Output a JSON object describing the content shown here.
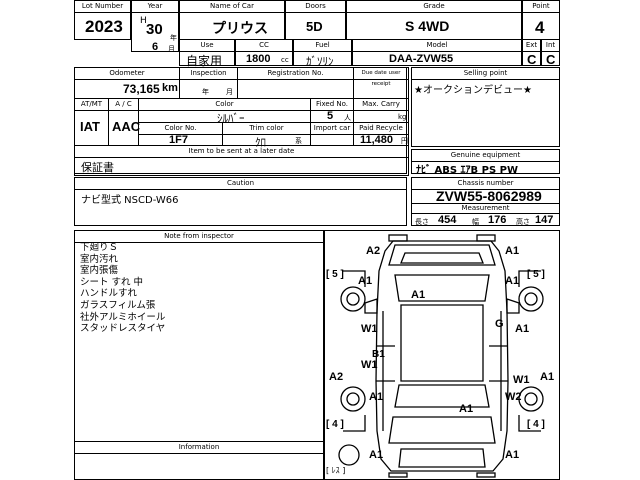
{
  "header": {
    "lot_no_label": "Lot Number",
    "lot_no": "2023",
    "year_label": "Year",
    "era": "H",
    "year": "30",
    "year_unit": "年",
    "month": "6",
    "month_unit": "月",
    "name_label": "Name of Car",
    "name": "プリウス",
    "doors_label": "Doors",
    "doors": "5D",
    "grade_label": "Grade",
    "grade": "S 4WD",
    "point_label": "Point",
    "point": "4",
    "use_label": "Use",
    "use": "自家用",
    "cc_label": "CC",
    "cc": "1800",
    "cc_unit": "cc",
    "fuel_label": "Fuel",
    "fuel": "ｶﾞｿﾘﾝ",
    "model_label": "Model",
    "model": "DAA-ZVW55",
    "ext_label": "Ext",
    "ext": "C",
    "int_label": "Int",
    "int": "C"
  },
  "specs": {
    "odometer_label": "Odometer",
    "odometer": "73,165",
    "odometer_unit": "km",
    "inspection_label": "Inspection",
    "insp_year_unit": "年",
    "insp_month_unit": "月",
    "registration_label": "Registration No.",
    "due_date_label": "Due date user receipt",
    "at_mt_label": "AT/MT",
    "at_mt": "IAT",
    "ac_label": "A / C",
    "ac": "AAC",
    "color_label": "Color",
    "color": "ｼﾙﾊﾞｰ",
    "fixed_no_label": "Fixed No.",
    "fixed_no": "5",
    "fixed_no_unit": "人",
    "max_carry_label": "Max. Carry",
    "max_carry_unit": "kg",
    "color_no_label": "Color No.",
    "color_no": "1F7",
    "trim_color_label": "Trim color",
    "trim_color": "ｸﾛ",
    "trim_unit": "系",
    "import_label": "Import car",
    "recycle_label": "Paid Recycle",
    "recycle": "11,480",
    "recycle_unit": "円",
    "items_label": "Item to be sent at a later date",
    "items": "保証書"
  },
  "selling": {
    "label": "Selling point",
    "text": "★オークションデビュー★"
  },
  "equipment": {
    "label": "Genuine equipment",
    "text": "ﾅﾋﾞ  ABS  ｴｱB  PS  PW"
  },
  "caution": {
    "label": "Caution",
    "text": "ナビ型式 NSCD-W66"
  },
  "chassis": {
    "label": "Chassis number",
    "number": "ZVW55-8062989",
    "measure_label": "Measurement",
    "len_label": "長さ",
    "length": "454",
    "wid_label": "幅",
    "width": "176",
    "hgt_label": "高さ",
    "height": "147"
  },
  "inspector": {
    "label": "Note from inspector",
    "notes": [
      "下廻りＳ",
      "室内汚れ",
      "室内張傷",
      "シート すれ 中",
      "ハンドルすれ",
      "ガラスフィルム張",
      "社外アルミホイール",
      "スタッドレスタイヤ"
    ]
  },
  "information": {
    "label": "Information"
  },
  "diagram": {
    "marks": [
      "A2",
      "A1",
      "A1",
      "A1",
      "A1",
      "G",
      "W1",
      "A1",
      "B1",
      "W1",
      "A2",
      "W1",
      "A1",
      "A1",
      "A1",
      "W2",
      "A1",
      "A1"
    ],
    "tire_l1": "[ 5 ]",
    "tire_r1": "[ 5 ]",
    "tire_l2": "[ 4 ]",
    "tire_r2": "[ 4 ]",
    "spare": "[ ﾚｽ ]"
  }
}
